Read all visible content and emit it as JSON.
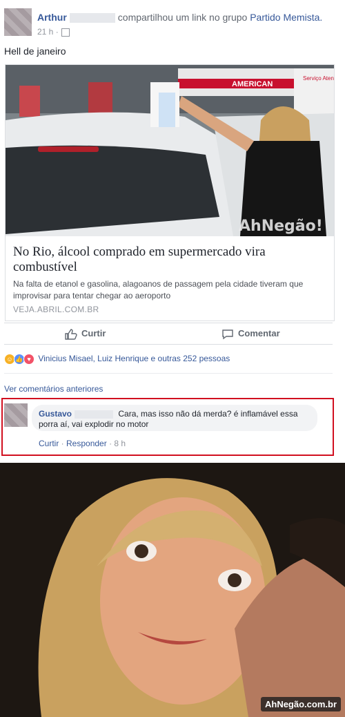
{
  "post": {
    "author": "Arthur",
    "shared_text": "compartilhou um link no grupo",
    "group": "Partido Memista.",
    "time": "21 h ·",
    "text": "Hell de janeiro"
  },
  "link": {
    "title": "No Rio, álcool comprado em supermercado vira combustível",
    "description": "Na falta de etanol e gasolina, alagoanos de passagem pela cidade tiveram que improvisar para tentar chegar ao aeroporto",
    "domain": "VEJA.ABRIL.COM.BR",
    "sign_american": "AMERICAN",
    "sign_servico": "Serviço Atendido",
    "image_watermark": "AhNegão!"
  },
  "actions": {
    "like": "Curtir",
    "comment": "Comentar"
  },
  "reactions": {
    "text": "Vinicius Misael, Luiz Henrique e outras 252 pessoas",
    "icons": [
      "haha-icon",
      "like-icon",
      "love-icon"
    ]
  },
  "comments": {
    "prev_label": "Ver comentários anteriores",
    "items": [
      {
        "name": "Gustavo",
        "text": "Cara, mas isso não dá merda? é inflamável essa porra aí, vai explodir no motor",
        "like": "Curtir",
        "reply": "Responder",
        "time": "8 h"
      }
    ]
  },
  "meme": {
    "watermark": "AhNegão.com.br"
  },
  "colors": {
    "link_blue": "#365899",
    "highlight_red": "#d10f1f",
    "card_border": "#dddfe2"
  }
}
